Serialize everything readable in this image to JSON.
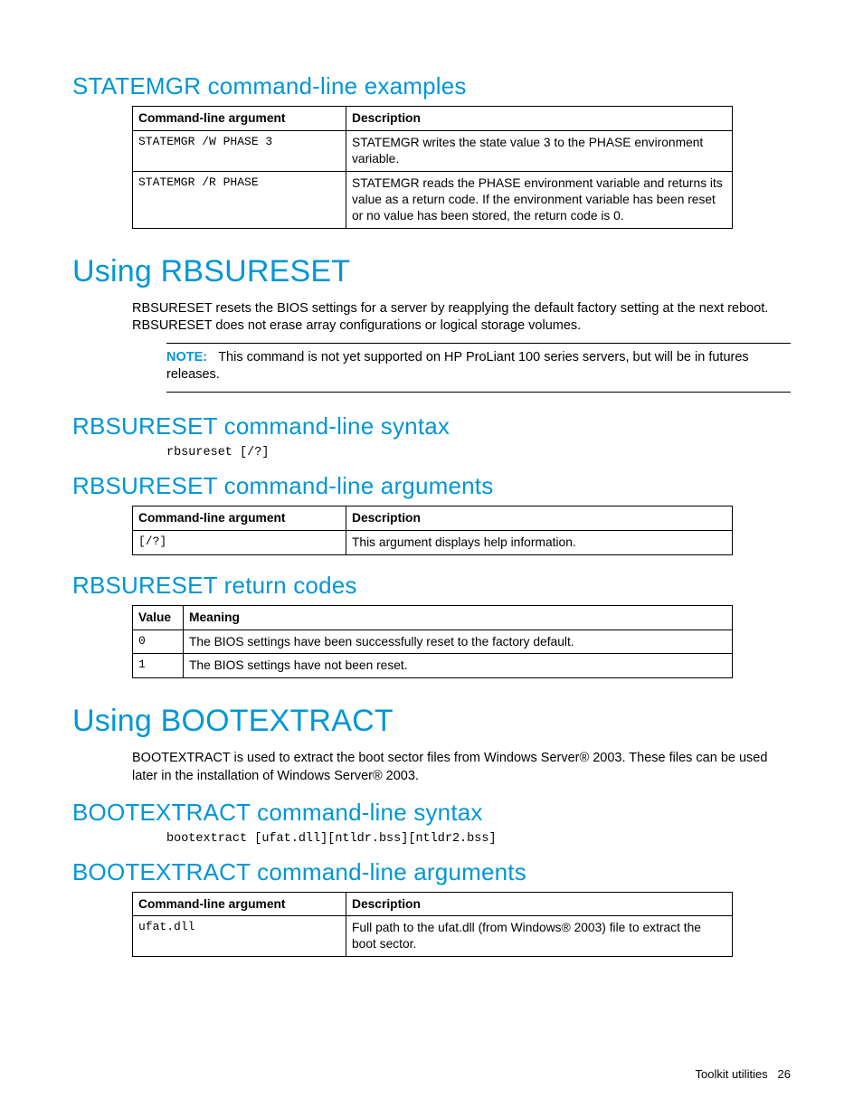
{
  "section1": {
    "heading": "STATEMGR command-line examples",
    "table": {
      "headers": [
        "Command-line argument",
        "Description"
      ],
      "rows": [
        {
          "arg": "STATEMGR /W PHASE 3",
          "desc": "STATEMGR writes the state value 3 to the PHASE environment variable."
        },
        {
          "arg": "STATEMGR /R PHASE",
          "desc": "STATEMGR reads the PHASE environment variable and returns its value as a return code. If the environment variable has been reset or no value has been stored, the return code is 0."
        }
      ]
    }
  },
  "section2": {
    "heading": "Using RBSURESET",
    "para": "RBSURESET resets the BIOS settings for a server by reapplying the default factory setting at the next reboot. RBSURESET does not erase array configurations or logical storage volumes.",
    "note_label": "NOTE:",
    "note_text": "This command is not yet supported on HP ProLiant 100 series servers, but will be in futures releases."
  },
  "section3": {
    "heading": "RBSURESET command-line syntax",
    "code": "rbsureset [/?]"
  },
  "section4": {
    "heading": "RBSURESET command-line arguments",
    "table": {
      "headers": [
        "Command-line argument",
        "Description"
      ],
      "rows": [
        {
          "arg": "[/?]",
          "desc": "This argument displays help information."
        }
      ]
    }
  },
  "section5": {
    "heading": "RBSURESET return codes",
    "table": {
      "headers": [
        "Value",
        "Meaning"
      ],
      "rows": [
        {
          "val": "0",
          "meaning": "The BIOS settings have been successfully reset to the factory default."
        },
        {
          "val": "1",
          "meaning": "The BIOS settings have not been reset."
        }
      ]
    }
  },
  "section6": {
    "heading": "Using BOOTEXTRACT",
    "para": "BOOTEXTRACT is used to extract the boot sector files from Windows Server® 2003. These files can be used later in the installation of Windows Server® 2003."
  },
  "section7": {
    "heading": "BOOTEXTRACT command-line syntax",
    "code": "bootextract [ufat.dll][ntldr.bss][ntldr2.bss]"
  },
  "section8": {
    "heading": "BOOTEXTRACT command-line arguments",
    "table": {
      "headers": [
        "Command-line argument",
        "Description"
      ],
      "rows": [
        {
          "arg": "ufat.dll",
          "desc": "Full path to the ufat.dll (from Windows® 2003) file to extract the boot sector."
        }
      ]
    }
  },
  "footer": {
    "text": "Toolkit utilities",
    "page": "26"
  }
}
